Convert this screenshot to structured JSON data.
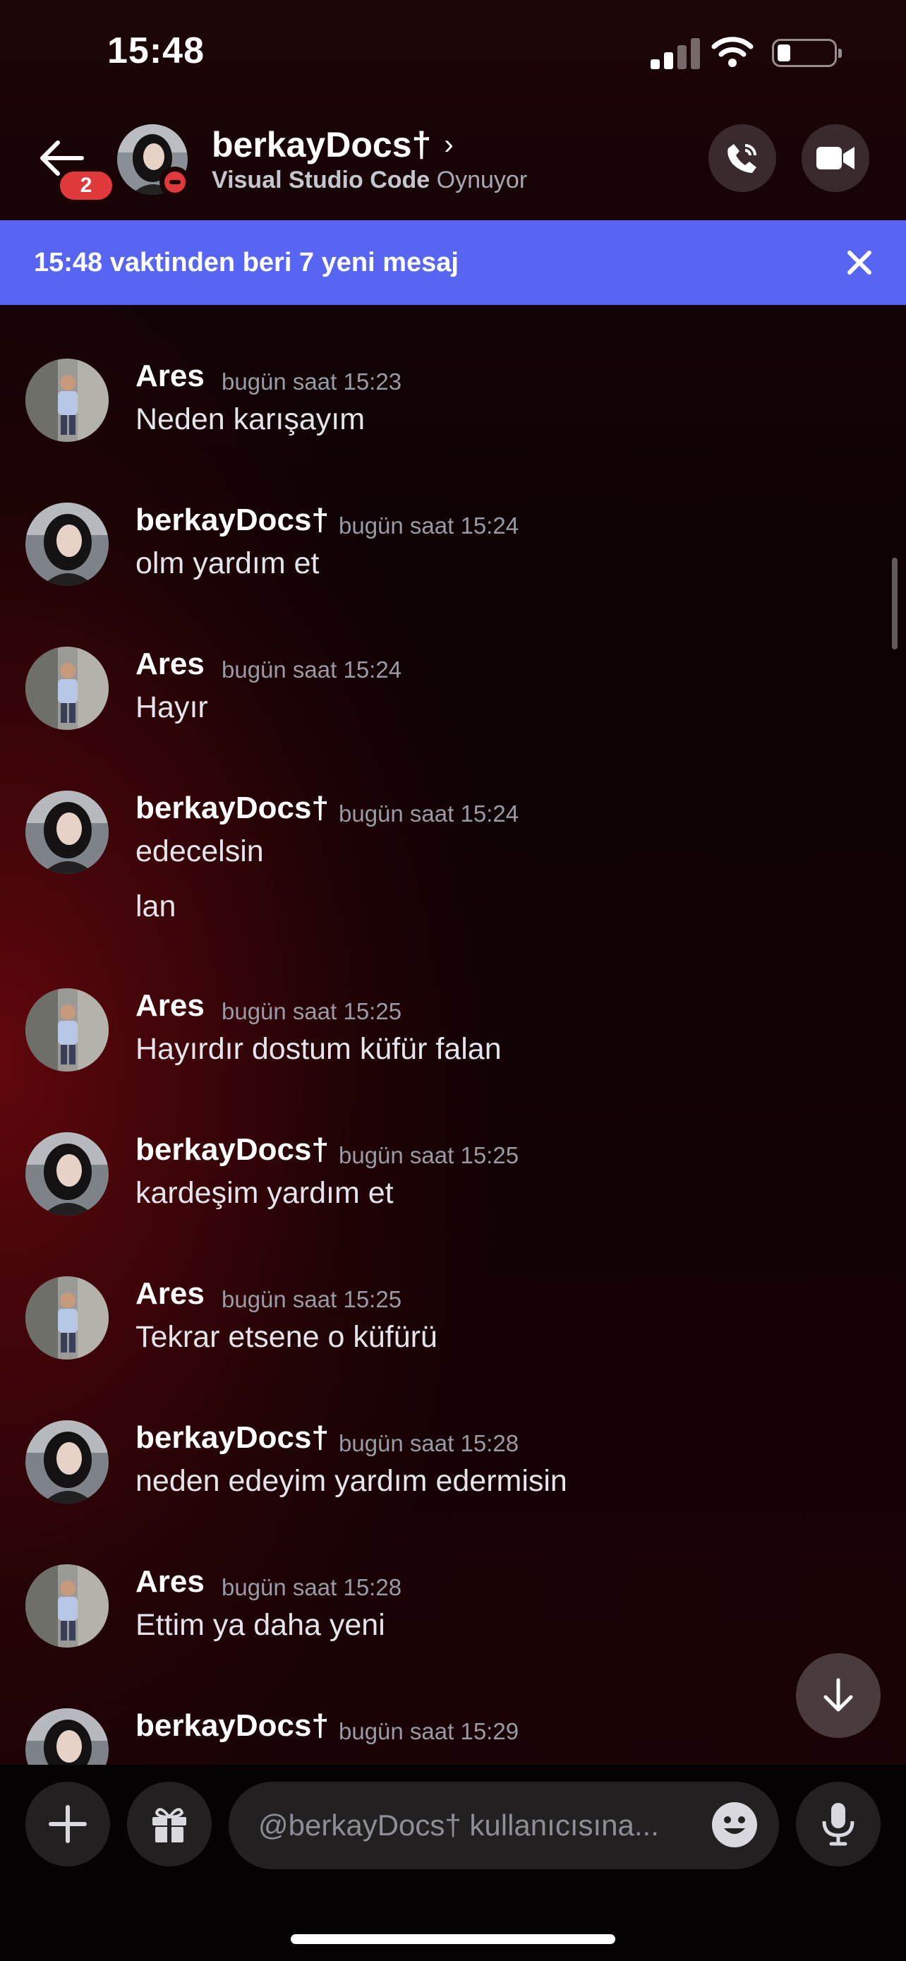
{
  "status_bar": {
    "time": "15:48"
  },
  "header": {
    "unread_badge": "2",
    "name": "berkayDocs†",
    "activity_app": "Visual Studio Code",
    "activity_verb": "Oynuyor"
  },
  "new_messages_bar": {
    "text": "15:48 vaktinden beri 7 yeni mesaj"
  },
  "messages": [
    {
      "author": "Ares",
      "timestamp": "bugün saat 15:23",
      "lines": [
        "Neden karışayım"
      ]
    },
    {
      "author": "berkayDocs†",
      "timestamp": "bugün saat 15:24",
      "lines": [
        "olm yardım et"
      ]
    },
    {
      "author": "Ares",
      "timestamp": "bugün saat 15:24",
      "lines": [
        "Hayır"
      ]
    },
    {
      "author": "berkayDocs†",
      "timestamp": "bugün saat 15:24",
      "lines": [
        "edecelsin",
        "lan"
      ]
    },
    {
      "author": "Ares",
      "timestamp": "bugün saat 15:25",
      "lines": [
        "Hayırdır dostum küfür falan"
      ]
    },
    {
      "author": "berkayDocs†",
      "timestamp": "bugün saat 15:25",
      "lines": [
        "kardeşim yardım et"
      ]
    },
    {
      "author": "Ares",
      "timestamp": "bugün saat 15:25",
      "lines": [
        "Tekrar etsene o küfürü"
      ]
    },
    {
      "author": "berkayDocs†",
      "timestamp": "bugün saat 15:28",
      "lines": [
        "neden edeyim yardım edermisin"
      ]
    },
    {
      "author": "Ares",
      "timestamp": "bugün saat 15:28",
      "lines": [
        "Ettim ya daha yeni"
      ]
    },
    {
      "author": "berkayDocs†",
      "timestamp": "bugün saat 15:29",
      "lines": []
    }
  ],
  "composer": {
    "placeholder": "@berkayDocs† kullanıcısına..."
  },
  "colors": {
    "accent": "#5865f2",
    "danger": "#e0393c"
  },
  "icons": [
    "back-arrow-icon",
    "phone-icon",
    "video-camera-icon",
    "close-icon",
    "arrow-down-icon",
    "plus-icon",
    "gift-icon",
    "emoji-icon",
    "microphone-icon"
  ]
}
